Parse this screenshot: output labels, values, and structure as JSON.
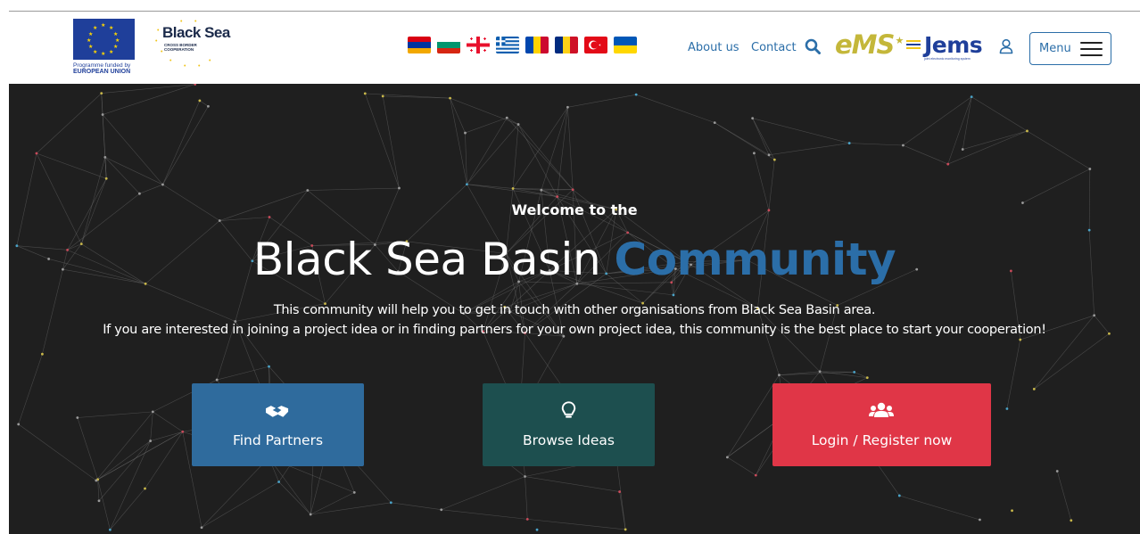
{
  "header": {
    "eu_caption_line1": "Programme funded by",
    "eu_caption_line2": "EUROPEAN UNION",
    "programme_logo_title": "Black Sea",
    "programme_logo_subtitle_1": "CROSS BORDER",
    "programme_logo_subtitle_2": "COOPERATION",
    "flags": [
      "Armenia",
      "Bulgaria",
      "Georgia",
      "Greece",
      "Moldova",
      "Romania",
      "Turkey",
      "Ukraine"
    ],
    "nav": {
      "about_label": "About us",
      "contact_label": "Contact"
    },
    "ems_logo": "eMS",
    "jems_logo": "Jems",
    "jems_tagline": "joint electronic monitoring system",
    "menu_label": "Menu"
  },
  "hero": {
    "welcome": "Welcome to the",
    "headline_main": "Black Sea Basin",
    "headline_highlight": "Community",
    "desc_line1": "This community will help you to get in touch with other organisations from Black Sea Basin area.",
    "desc_line2": "If you are interested in joining a project idea or in finding partners for your own project idea, this community is the best place to start your cooperation!",
    "buttons": {
      "find_partners": "Find Partners",
      "browse_ideas": "Browse Ideas",
      "login_register": "Login / Register now"
    }
  },
  "colors": {
    "primary_blue": "#2f6b9d",
    "teal": "#1d4f4f",
    "red": "#e03647",
    "hero_bg": "#1f1f1f",
    "ems_gold": "#c4b73a",
    "jems_blue": "#1f3f9a"
  },
  "icons": {
    "search": "search-icon",
    "user": "user-icon",
    "menu": "hamburger-icon",
    "partners": "handshake-icon",
    "ideas": "lightbulb-icon",
    "login": "users-icon"
  }
}
